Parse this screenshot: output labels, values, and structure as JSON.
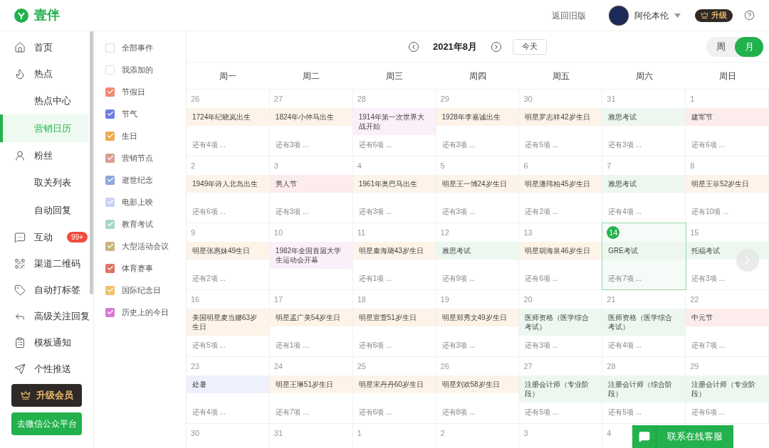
{
  "header": {
    "logo_text": "壹伴",
    "old_version_link": "返回旧版",
    "user_name": "阿伦本伦",
    "upgrade_badge": "升级"
  },
  "sidebar": {
    "items": [
      {
        "label": "首页",
        "selected": false
      },
      {
        "label": "热点",
        "selected": false,
        "children": [
          {
            "label": "热点中心",
            "selected": false
          },
          {
            "label": "营销日历",
            "selected": true
          }
        ]
      },
      {
        "label": "粉丝",
        "selected": false,
        "children": [
          {
            "label": "取关列表",
            "selected": false
          },
          {
            "label": "自动回复",
            "selected": false
          }
        ]
      },
      {
        "label": "互动",
        "selected": false,
        "badge": "99+"
      },
      {
        "label": "渠道二维码",
        "selected": false
      },
      {
        "label": "自动打标签",
        "selected": false
      },
      {
        "label": "高级关注回复",
        "selected": false
      },
      {
        "label": "模板通知",
        "selected": false
      },
      {
        "label": "个性推送",
        "selected": false
      }
    ],
    "vip_button": "升级会员",
    "platform_button": "去微信公众平台"
  },
  "filters": [
    {
      "label": "全部事件",
      "checked": false
    },
    {
      "label": "我添加的",
      "checked": false
    },
    {
      "label": "节假日",
      "checked": true,
      "color": "#f08a73"
    },
    {
      "label": "节气",
      "checked": true,
      "color": "#6b7fe0"
    },
    {
      "label": "生日",
      "checked": true,
      "color": "#f0a94e"
    },
    {
      "label": "营销节点",
      "checked": true,
      "color": "#d9a091"
    },
    {
      "label": "逝世纪念",
      "checked": true,
      "color": "#8fa8d9"
    },
    {
      "label": "电影上映",
      "checked": true,
      "color": "#c9d2f5"
    },
    {
      "label": "教育考试",
      "checked": true,
      "color": "#a6d6c8"
    },
    {
      "label": "大型活动会议",
      "checked": true,
      "color": "#cbb57a"
    },
    {
      "label": "体育赛事",
      "checked": true,
      "color": "#dd7463"
    },
    {
      "label": "国际纪念日",
      "checked": true,
      "color": "#f0c06c"
    },
    {
      "label": "历史上的今日",
      "checked": true,
      "color": "#d77bd9"
    }
  ],
  "toolbar": {
    "month": "2021年8月",
    "today_button": "今天",
    "view_tabs": [
      {
        "label": "周",
        "selected": false
      },
      {
        "label": "月",
        "selected": true
      }
    ]
  },
  "weekdays": [
    "周一",
    "周二",
    "周三",
    "周四",
    "周五",
    "周六",
    "周日"
  ],
  "weeks": [
    [
      {
        "date": "26",
        "today": false,
        "event": {
          "title": "1724年纪晓岚出生",
          "color": "#fdf3e8"
        },
        "more": "还有4项 ..."
      },
      {
        "date": "27",
        "today": false,
        "event": {
          "title": "1824年小仲马出生",
          "color": "#fdf3e8"
        },
        "more": "还有3项 ..."
      },
      {
        "date": "28",
        "today": false,
        "event": {
          "title": "1914年第一次世界大战开始",
          "color": "#fbf0f9"
        },
        "more": "还有6项 ..."
      },
      {
        "date": "29",
        "today": false,
        "event": {
          "title": "1928年李嘉诚出生",
          "color": "#fdf3e8"
        },
        "more": "还有3项 ..."
      },
      {
        "date": "30",
        "today": false,
        "event": {
          "title": "明星罗志祥42岁生日",
          "color": "#fdf3e8"
        },
        "more": "还有5项 ..."
      },
      {
        "date": "31",
        "today": false,
        "event": {
          "title": "雅思考试",
          "color": "#edf7f0"
        },
        "more": "还有3项 ..."
      },
      {
        "date": "1",
        "today": false,
        "event": {
          "title": "建军节",
          "color": "#fdecec"
        },
        "more": "还有6项 ..."
      }
    ],
    [
      {
        "date": "2",
        "today": false,
        "event": {
          "title": "1949年诗人北岛出生",
          "color": "#fdf3e8"
        },
        "more": "还有6项 ..."
      },
      {
        "date": "3",
        "today": false,
        "event": {
          "title": "男人节",
          "color": "#fdecec"
        },
        "more": "还有3项 ..."
      },
      {
        "date": "4",
        "today": false,
        "event": {
          "title": "1961年奥巴马出生",
          "color": "#fdf3e8"
        },
        "more": "还有3项 ..."
      },
      {
        "date": "5",
        "today": false,
        "event": {
          "title": "明星王一博24岁生日",
          "color": "#fdf3e8"
        },
        "more": "还有3项 ..."
      },
      {
        "date": "6",
        "today": false,
        "event": {
          "title": "明星潘玮柏45岁生日",
          "color": "#fdf3e8"
        },
        "more": "还有2项 ..."
      },
      {
        "date": "7",
        "today": false,
        "event": {
          "title": "雅思考试",
          "color": "#edf7f0"
        },
        "more": "还有4项 ..."
      },
      {
        "date": "8",
        "today": false,
        "event": {
          "title": "明星王菲52岁生日",
          "color": "#fdf3e8"
        },
        "more": "还有10项 ..."
      }
    ],
    [
      {
        "date": "9",
        "today": false,
        "event": {
          "title": "明星张惠妹49生日",
          "color": "#fdf3e8"
        },
        "more": "还有2项 ..."
      },
      {
        "date": "10",
        "today": false,
        "event": {
          "title": "1982年全国首届大学生运动会开幕",
          "color": "#fbf0f9"
        }
      },
      {
        "date": "11",
        "today": false,
        "event": {
          "title": "明星秦海璐43岁生日",
          "color": "#fdf3e8"
        },
        "more": "还有1项 ..."
      },
      {
        "date": "12",
        "today": false,
        "event": {
          "title": "雅思考试",
          "color": "#edf7f0"
        },
        "more": "还有9项 ..."
      },
      {
        "date": "13",
        "today": false,
        "event": {
          "title": "明星胡海泉46岁生日",
          "color": "#fdf3e8"
        },
        "more": "还有6项 ..."
      },
      {
        "date": "14",
        "today": true,
        "event": {
          "title": "GRE考试",
          "color": "#edf7f0"
        },
        "more": "还有7项 ..."
      },
      {
        "date": "15",
        "today": false,
        "event": {
          "title": "托福考试",
          "color": "#edf7f0"
        },
        "more": "还有3项 ..."
      }
    ],
    [
      {
        "date": "16",
        "today": false,
        "event": {
          "title": "美国明星麦当娜63岁生日",
          "color": "#fdf3e8"
        },
        "more": "还有5项 ..."
      },
      {
        "date": "17",
        "today": false,
        "event": {
          "title": "明星孟广美54岁生日",
          "color": "#fdf3e8"
        },
        "more": "还有1项 ..."
      },
      {
        "date": "18",
        "today": false,
        "event": {
          "title": "明星宣萱51岁生日",
          "color": "#fdf3e8"
        },
        "more": "还有6项 ..."
      },
      {
        "date": "19",
        "today": false,
        "event": {
          "title": "明星郑秀文49岁生日",
          "color": "#fdf3e8"
        },
        "more": "还有3项 ..."
      },
      {
        "date": "20",
        "today": false,
        "event": {
          "title": "医师资格（医学综合考试）",
          "color": "#edf7f0"
        },
        "more": "还有3项 ..."
      },
      {
        "date": "21",
        "today": false,
        "event": {
          "title": "医师资格（医学综合考试）",
          "color": "#edf7f0"
        },
        "more": "还有4项 ..."
      },
      {
        "date": "22",
        "today": false,
        "event": {
          "title": "中元节",
          "color": "#fdecec"
        },
        "more": "还有7项 ..."
      }
    ],
    [
      {
        "date": "23",
        "today": false,
        "event": {
          "title": "处暑",
          "color": "#eef1fd"
        },
        "more": "还有4项 ..."
      },
      {
        "date": "24",
        "today": false,
        "event": {
          "title": "明星王琳51岁生日",
          "color": "#fdf3e8"
        },
        "more": "还有7项 ..."
      },
      {
        "date": "25",
        "today": false,
        "event": {
          "title": "明星宋丹丹60岁生日",
          "color": "#fdf3e8"
        },
        "more": "还有6项 ..."
      },
      {
        "date": "26",
        "today": false,
        "event": {
          "title": "明星刘欢58岁生日",
          "color": "#fdf3e8"
        },
        "more": "还有8项 ..."
      },
      {
        "date": "27",
        "today": false,
        "event": {
          "title": "注册会计师（专业阶段）",
          "color": "#edf7f0"
        },
        "more": "还有5项 ..."
      },
      {
        "date": "28",
        "today": false,
        "event": {
          "title": "注册会计师（综合阶段）",
          "color": "#edf7f0"
        },
        "more": "还有5项 ..."
      },
      {
        "date": "29",
        "today": false,
        "event": {
          "title": "注册会计师（专业阶段）",
          "color": "#edf7f0"
        },
        "more": "还有6项 ..."
      }
    ],
    [
      {
        "date": "30",
        "today": false
      },
      {
        "date": "31",
        "today": false
      },
      {
        "date": "1",
        "today": false
      },
      {
        "date": "2",
        "today": false
      },
      {
        "date": "3",
        "today": false
      },
      {
        "date": "4",
        "today": false
      }
    ]
  ],
  "contact_button": "联系在线客服"
}
